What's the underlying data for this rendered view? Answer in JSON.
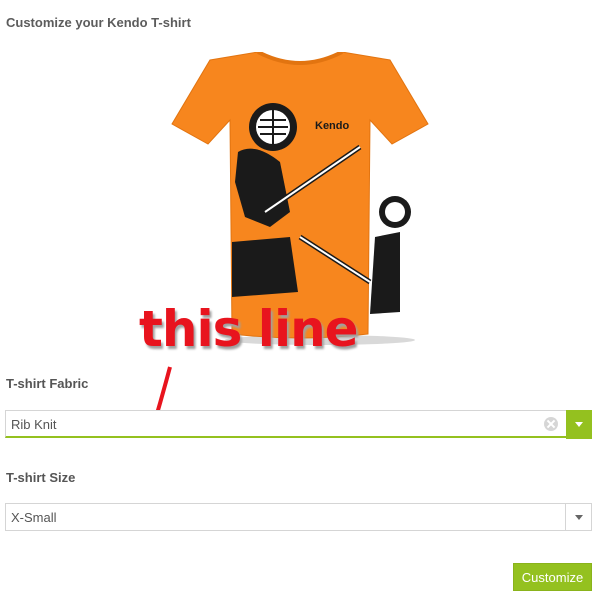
{
  "page": {
    "title": "Customize your Kendo T-shirt"
  },
  "product": {
    "brand_label": "Kendo"
  },
  "annotation": {
    "text": "this line"
  },
  "fabric": {
    "label": "T-shirt Fabric",
    "value": "Rib Knit"
  },
  "size": {
    "label": "T-shirt Size",
    "value": "X-Small"
  },
  "actions": {
    "customize_label": "Customize"
  },
  "colors": {
    "accent": "#94c11f",
    "annotation": "#e8141e",
    "shirt": "#f7861e"
  }
}
